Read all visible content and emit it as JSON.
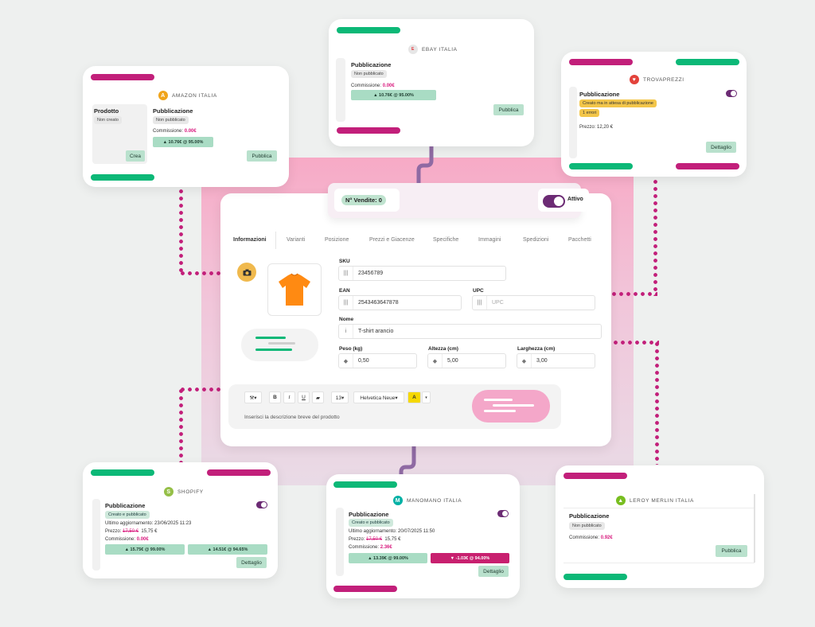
{
  "ebay": {
    "name": "EBAY ITALIA",
    "section": "Pubblicazione",
    "status": "Non pubblicato",
    "commission_label": "Commissione:",
    "commission_value": "0.00€",
    "bar": "▲ 10.76€ @ 95.00%",
    "button": "Pubblica"
  },
  "amazon": {
    "name": "AMAZON ITALIA",
    "product_label": "Prodotto",
    "product_status": "Non creato",
    "create_button": "Crea",
    "section": "Pubblicazione",
    "status": "Non pubblicato",
    "commission_label": "Commissione:",
    "commission_value": "0.00€",
    "bar": "▲ 10.76€ @ 95.00%",
    "button": "Pubblica"
  },
  "trovaprezzi": {
    "name": "TROVAPREZZI",
    "section": "Pubblicazione",
    "status_1": "Creato ma in attesa di pubblicazione",
    "status_2": "1 errori",
    "price": "Prezzo: 12,20 €",
    "button": "Dettaglio"
  },
  "main": {
    "sales_label": "N° Vendite: 0",
    "active_label": "Attivo",
    "tabs": [
      "Informazioni",
      "Varianti",
      "Posizione",
      "Prezzi e Giacenze",
      "Specifiche",
      "Immagini",
      "Spedizioni",
      "Pacchetti"
    ],
    "sku_label": "SKU",
    "sku_value": "23456789",
    "ean_label": "EAN",
    "ean_value": "2543463647878",
    "upc_label": "UPC",
    "upc_placeholder": "UPC",
    "name_label": "Nome",
    "name_value": "T-shirt arancio",
    "weight_label": "Peso (kg)",
    "weight_value": "0,50",
    "height_label": "Altezza (cm)",
    "height_value": "5,00",
    "width_label": "Larghezza (cm)",
    "width_value": "3,00",
    "toolbar": {
      "bold": "B",
      "italic": "I",
      "underline": "U",
      "size": "13▾",
      "font": "Helvetica Neue▾",
      "color": "A",
      "color_caret": "▾"
    },
    "description_placeholder": "Inserisci la descrizione breve del prodotto"
  },
  "shopify": {
    "name": "SHOPIFY",
    "section": "Pubblicazione",
    "status": "Creato e pubblicato",
    "updated": "Ultimo aggiornamento: 23/06/2025 11:23",
    "price_label": "Prezzo:",
    "price_old": "17,50 €",
    "price_new": "15,75 €",
    "commission_label": "Commissione:",
    "commission_value": "0.00€",
    "bar_1": "▲ 15.75€ @ 99.00%",
    "bar_2": "▲ 14.51€ @ 94.65%",
    "button": "Dettaglio"
  },
  "manomano": {
    "name": "MANOMANO ITALIA",
    "section": "Pubblicazione",
    "status": "Creato e pubblicato",
    "updated": "Ultimo aggiornamento: 20/07/2025 11:50",
    "price_label": "Prezzo:",
    "price_old": "17,50 €",
    "price_new": "15,75 €",
    "commission_label": "Commissione:",
    "commission_value": "2.36€",
    "bar_1": "▲ 13.39€ @ 99.00%",
    "bar_2": "▼ -1.03€ @ 94.00%",
    "button": "Dettaglio"
  },
  "leroy": {
    "name": "LEROY MERLIN ITALIA",
    "section": "Pubblicazione",
    "status": "Non pubblicato",
    "commission_label": "Commissione:",
    "commission_value": "0.92€",
    "button": "Pubblica"
  },
  "colors": {
    "green": "#0cb877",
    "magenta": "#c21f7a",
    "pink_bg": "#f6b4cc",
    "purple": "#8f6aa3"
  },
  "icons": [
    "camera-icon",
    "barcode-icon",
    "info-icon",
    "cube-icon",
    "magic-wand-icon",
    "eraser-icon",
    "text-color-icon",
    "tshirt-icon"
  ]
}
